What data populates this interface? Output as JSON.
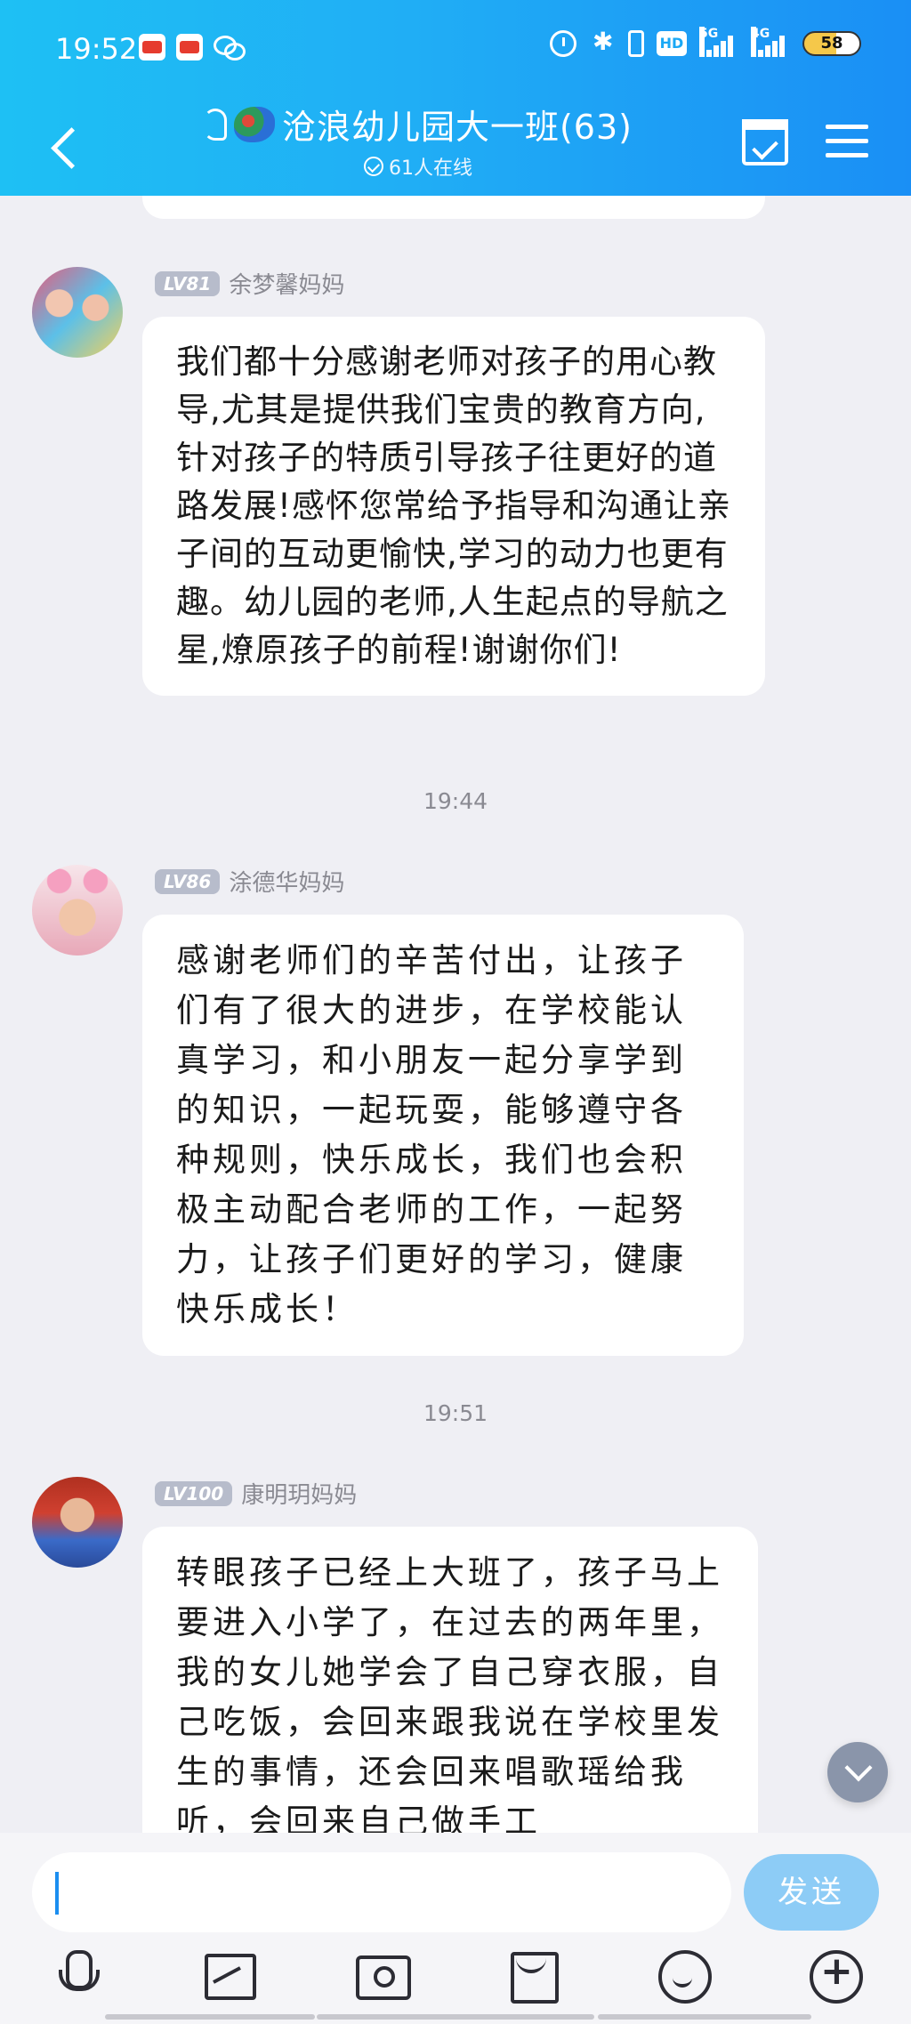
{
  "status_bar": {
    "time": "19:52",
    "battery": "58",
    "hd_label": "HD",
    "signal_5g": "5G",
    "signal_4g": "4G"
  },
  "header": {
    "group_title": "沧浪幼儿园大一班(63)",
    "online_text": "61人在线"
  },
  "messages": [
    {
      "level": "LV81",
      "sender": "余梦馨妈妈",
      "text": "我们都十分感谢老师对孩子的用心教导,尤其是提供我们宝贵的教育方向,针对孩子的特质引导孩子往更好的道路发展!感怀您常给予指导和沟通让亲子间的互动更愉快,学习的动力也更有趣。幼儿园的老师,人生起点的导航之星,燎原孩子的前程!谢谢你们!"
    },
    {
      "timestamp": "19:44",
      "level": "LV86",
      "sender": "涂德华妈妈",
      "text": "感谢老师们的辛苦付出，让孩子们有了很大的进步，在学校能认真学习，和小朋友一起分享学到的知识，一起玩耍，能够遵守各种规则，快乐成长，我们也会积极主动配合老师的工作，一起努力，让孩子们更好的学习，健康快乐成长！"
    },
    {
      "timestamp": "19:51",
      "level": "LV100",
      "sender": "康明玥妈妈",
      "text": "转眼孩子已经上大班了，孩子马上要进入小学了，在过去的两年里，我的女儿她学会了自己穿衣服，自己吃饭，会回来跟我说在学校里发生的事情，还会回来唱歌瑶给我听，会回来自己做手工"
    }
  ],
  "input": {
    "value": "",
    "send_label": "发送"
  },
  "colors": {
    "header_start": "#1ec0f4",
    "header_end": "#1a8ff5",
    "send_button": "#8dccf6",
    "chat_background": "#efeff4"
  },
  "toolbar_icons": [
    "mic-icon",
    "image-icon",
    "camera-icon",
    "redpacket-icon",
    "emoji-icon",
    "plus-icon"
  ]
}
